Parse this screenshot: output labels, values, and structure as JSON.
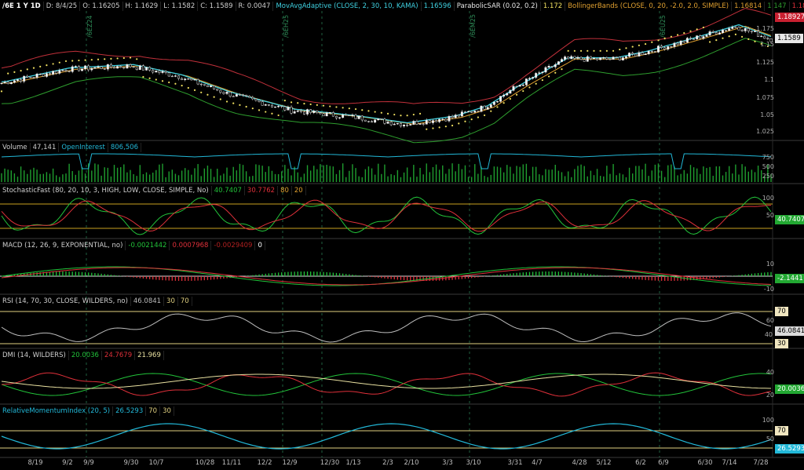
{
  "header": {
    "symbol": "/6E 1 Y 1D",
    "date": "D: 8/4/25",
    "open": "O: 1.16205",
    "high": "H: 1.1629",
    "low": "L: 1.1582",
    "close": "C: 1.1589",
    "range": "R: 0.0047",
    "mov_avg_label": "MovAvgAdaptive (CLOSE, 2, 30, 10, KAMA)",
    "mov_avg_value": "1.16596",
    "psar_label": "ParabolicSAR (0.02, 0.2)",
    "psar_value": "1.172",
    "bb_label": "BollingerBands (CLOSE, 0, 20, -2.0, 2.0, SIMPLE)",
    "bb_mid": "1.16814",
    "bb_low": "1.147",
    "bb_up": "1.18927"
  },
  "price_axis": {
    "ticks": [
      "1.175",
      "1.15",
      "1.125",
      "1.1",
      "1.075",
      "1.05",
      "1.025"
    ],
    "badge_upper": "1.18927",
    "badge_price": "1.1589"
  },
  "contract_marks": [
    "/6EZ24",
    "/6EH25",
    "/6EM25",
    "/6EU25"
  ],
  "volume": {
    "label": "Volume",
    "value": "47,141",
    "oi_label": "OpenInterest",
    "oi_value": "806,506",
    "ticks": [
      "750",
      "500",
      "250"
    ]
  },
  "stoch": {
    "label": "StochasticFast (80, 20, 10, 3, HIGH, LOW, CLOSE, SIMPLE, No)",
    "k": "40.7407",
    "d": "30.7762",
    "ob": "80",
    "os": "20",
    "ticks": [
      "100",
      "50"
    ],
    "badge": "40.7407"
  },
  "macd": {
    "label": "MACD (12, 26, 9, EXPONENTIAL, no)",
    "value": "-0.0021442",
    "avg": "0.0007968",
    "diff": "-0.0029409",
    "zero": "0",
    "ticks": [
      "10",
      "-10"
    ],
    "badge": "-2.1441"
  },
  "rsi": {
    "label": "RSI (14, 70, 30, CLOSE, WILDERS, no)",
    "value": "46.0841",
    "os": "30",
    "ob": "70",
    "ticks": [
      "70",
      "60",
      "40",
      "30"
    ],
    "badge": "46.0841"
  },
  "dmi": {
    "label": "DMI (14, WILDERS)",
    "plus": "20.0036",
    "minus": "24.7679",
    "adx": "21.969",
    "ticks": [
      "40",
      "20"
    ],
    "badge": "20.0036"
  },
  "rmi": {
    "label": "RelativeMomentumIndex (20, 5)",
    "value": "26.5293",
    "ob": "70",
    "os": "30",
    "ticks": [
      "100",
      "70",
      "50"
    ],
    "badge_ob": "70",
    "badge": "26.5293"
  },
  "x_axis": [
    "8/19",
    "9/2",
    "9/9",
    "9/30",
    "10/7",
    "10/28",
    "11/11",
    "12/2",
    "12/9",
    "12/30",
    "1/13",
    "2/3",
    "2/10",
    "3/3",
    "3/10",
    "3/31",
    "4/7",
    "4/28",
    "5/12",
    "6/2",
    "6/9",
    "6/30",
    "7/14",
    "7/28"
  ],
  "colors": {
    "kama": "#3fd0e0",
    "psar": "#f0e060",
    "bb_up": "#c0303a",
    "bb_mid": "#e0a030",
    "bb_low": "#2e9e2e",
    "green": "#22c33a",
    "red": "#e0303a",
    "cyan": "#22b8d8"
  }
}
